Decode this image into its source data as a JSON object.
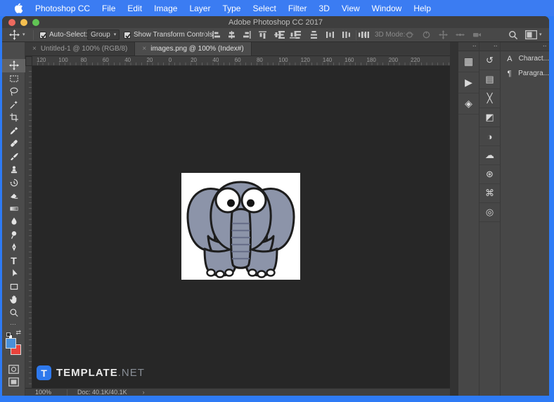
{
  "menu_bar": {
    "items": [
      "Photoshop CC",
      "File",
      "Edit",
      "Image",
      "Layer",
      "Type",
      "Select",
      "Filter",
      "3D",
      "View",
      "Window",
      "Help"
    ]
  },
  "title_bar": {
    "title": "Adobe Photoshop CC 2017"
  },
  "options_bar": {
    "auto_select_label": "Auto-Select:",
    "auto_select_checked": true,
    "auto_select_value": "Group",
    "show_transform_label": "Show Transform Controls",
    "show_transform_checked": true,
    "mode_3d_label": "3D Mode:"
  },
  "tabs": [
    {
      "close": "×",
      "label": "Untitled-1 @ 100% (RGB/8)",
      "active": false
    },
    {
      "close": "×",
      "label": "images.png @ 100% (Index#)",
      "active": true
    }
  ],
  "ruler": {
    "numbers": [
      "120",
      "100",
      "80",
      "60",
      "40",
      "20",
      "0",
      "20",
      "40",
      "60",
      "80",
      "100",
      "120",
      "140",
      "160",
      "180",
      "200",
      "220"
    ]
  },
  "tools": [
    "move",
    "rectangular-marquee",
    "lasso",
    "quick-selection",
    "crop",
    "eyedropper",
    "spot-healing",
    "brush",
    "clone-stamp",
    "history-brush",
    "eraser",
    "gradient",
    "blur",
    "dodge",
    "pen",
    "type",
    "path-selection",
    "rectangle-shape",
    "hand",
    "zoom"
  ],
  "tool_strip": {
    "ellipsis": "…",
    "swap_glyph": "⇄",
    "type_glyph": "T"
  },
  "tool_colors": {
    "foreground": "#4a90d8",
    "background": "#e8433c"
  },
  "icons": {
    "chevron_down": "▾",
    "collapse": "▪▪",
    "swatches": "▦",
    "actions": "▶",
    "layers": "◈",
    "history": "↺",
    "properties": "▤",
    "tool_presets": "╳",
    "adjustments": "◩",
    "styles": "◑",
    "libraries": "☁",
    "patterns": "⊛",
    "nodes": "⌘",
    "smudge": "◎",
    "character": "A",
    "paragraph": "¶"
  },
  "panels": {
    "character_label": "Charact...",
    "paragraph_label": "Paragra..."
  },
  "status_bar": {
    "zoom": "100%",
    "doc": "Doc: 40.1K/40.1K",
    "chevron": "›"
  },
  "canvas": {
    "content": "cartoon-elephant-image",
    "background": "#ffffff"
  },
  "watermark": {
    "badge_letter": "T",
    "brand": "TEMPLATE",
    "tld": ".NET",
    "badge_color": "#2f7df6"
  },
  "colors": {
    "menu_bar": "#3b7cf2",
    "desktop": "#2e7bf6",
    "pasteboard": "#272727",
    "panel_bg": "#474747"
  }
}
